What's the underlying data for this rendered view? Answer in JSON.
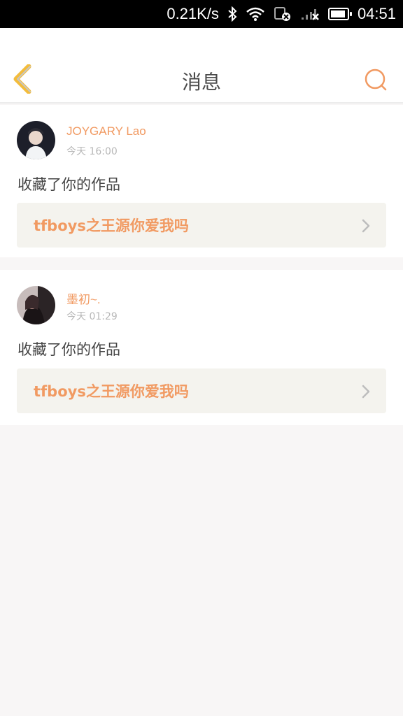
{
  "status_bar": {
    "network_speed": "0.21K/s",
    "time": "04:51",
    "icons": [
      "bluetooth-icon",
      "wifi-icon",
      "sim-error-icon",
      "signal-icon",
      "battery-icon"
    ]
  },
  "header": {
    "title": "消息",
    "back_icon": "chevron-left-icon",
    "search_icon": "search-icon",
    "accent_color": "#f19a62"
  },
  "messages": [
    {
      "username": "JOYGARY Lao",
      "time": "今天 16:00",
      "action": "收藏了你的作品",
      "work_title": "tfboys之王源你爱我吗"
    },
    {
      "username": "墨初~.",
      "time": "今天 01:29",
      "action": "收藏了你的作品",
      "work_title": "tfboys之王源你爱我吗"
    }
  ]
}
